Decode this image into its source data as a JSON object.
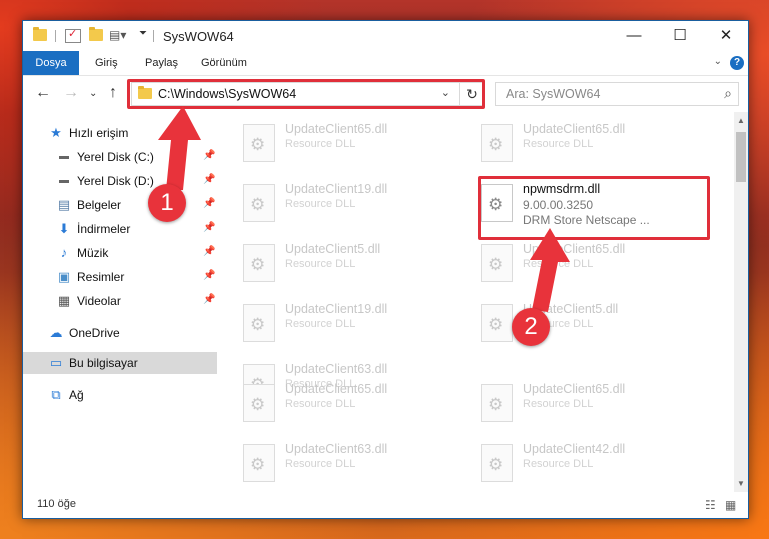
{
  "window": {
    "title": "SysWOW64",
    "controls": {
      "minimize": "—",
      "maximize": "☐",
      "close": "✕"
    }
  },
  "ribbon": {
    "tabs": [
      "Dosya",
      "Giriş",
      "Paylaş",
      "Görünüm"
    ],
    "help": "?"
  },
  "address": {
    "path": "C:\\Windows\\SysWOW64",
    "search_placeholder": "Ara: SysWOW64"
  },
  "sidebar": {
    "quick_access": "Hızlı erişim",
    "items": [
      {
        "label": "Yerel Disk (C:)",
        "icon": "drive-icon"
      },
      {
        "label": "Yerel Disk (D:)",
        "icon": "drive-icon"
      },
      {
        "label": "Belgeler",
        "icon": "documents-icon"
      },
      {
        "label": "İndirmeler",
        "icon": "download-icon"
      },
      {
        "label": "Müzik",
        "icon": "music-icon"
      },
      {
        "label": "Resimler",
        "icon": "pictures-icon"
      },
      {
        "label": "Videolar",
        "icon": "videos-icon"
      }
    ],
    "onedrive": "OneDrive",
    "this_pc": "Bu bilgisayar",
    "network": "Ağ"
  },
  "files": {
    "left": [
      {
        "name": "UpdateClient65.dll",
        "type": "Resource DLL"
      },
      {
        "name": "UpdateClient19.dll",
        "type": "Resource DLL"
      },
      {
        "name": "UpdateClient5.dll",
        "type": "Resource DLL"
      },
      {
        "name": "UpdateClient19.dll",
        "type": "Resource DLL"
      },
      {
        "name": "UpdateClient63.dll",
        "type": "Resource DLL"
      },
      {
        "name": "UpdateClient65.dll",
        "type": "Resource DLL"
      },
      {
        "name": "UpdateClient63.dll",
        "type": "Resource DLL"
      }
    ],
    "right": [
      {
        "name": "UpdateClient65.dll",
        "type": "Resource DLL"
      },
      {
        "name": "UpdateClient65.dll",
        "type": "Resource DLL"
      },
      {
        "name": "UpdateClient5.dll",
        "type": "Resource DLL"
      },
      {
        "name": "UpdateClient65.dll",
        "type": "Resource DLL"
      },
      {
        "name": "UpdateClient42.dll",
        "type": "Resource DLL"
      }
    ],
    "highlighted": {
      "name": "npwmsdrm.dll",
      "version": "9.00.00.3250",
      "description": "DRM Store Netscape ..."
    }
  },
  "status": {
    "item_count": "110 öğe"
  },
  "annotations": {
    "badge1": "1",
    "badge2": "2"
  },
  "colors": {
    "accent": "#1a6ec2",
    "highlight": "#e02f3a"
  }
}
